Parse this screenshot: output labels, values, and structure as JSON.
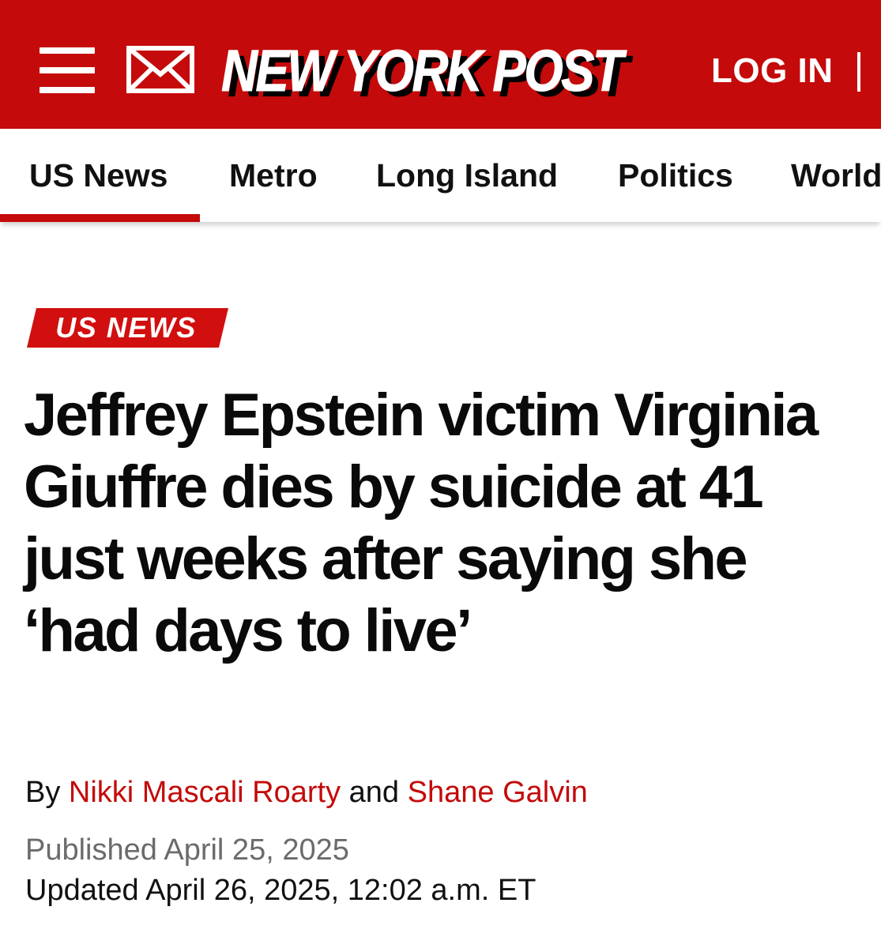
{
  "header": {
    "menu_icon": "hamburger-menu-icon",
    "mail_icon": "envelope-icon",
    "logo_text": "NEW YORK POST",
    "login_label": "LOG IN",
    "background_color": "#c40a0a"
  },
  "nav": {
    "items": [
      {
        "label": "US News",
        "active": true
      },
      {
        "label": "Metro"
      },
      {
        "label": "Long Island"
      },
      {
        "label": "Politics"
      },
      {
        "label": "World"
      }
    ]
  },
  "article": {
    "kicker": "US NEWS",
    "headline": "Jeffrey Epstein victim Virginia Giuffre dies by suicide at 41 just weeks after saying she ‘had days to live’",
    "byline": {
      "prefix": "By",
      "author1": "Nikki Mascali Roarty",
      "conjunction": "and",
      "author2": "Shane Galvin"
    },
    "published": "Published April 25, 2025",
    "updated": "Updated April 26, 2025, 12:02 a.m. ET"
  }
}
